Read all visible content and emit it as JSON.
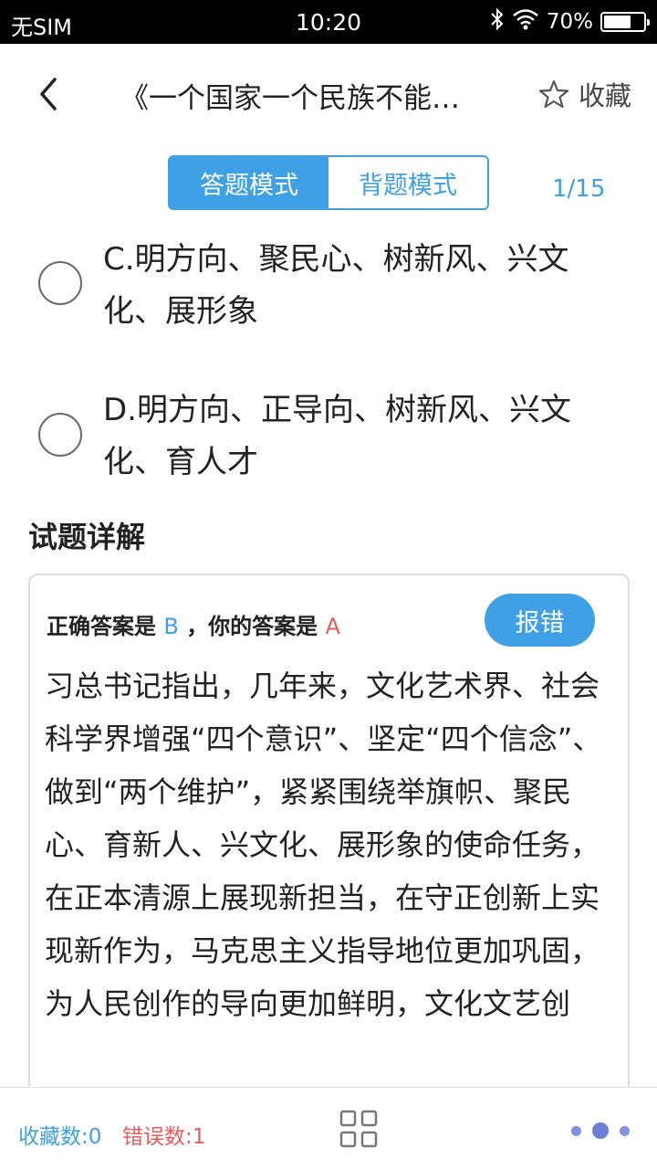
{
  "status_bar": {
    "carrier": "无SIM",
    "time": "10:20",
    "battery_percent": "70%",
    "battery_level": 0.7,
    "icons": [
      "bluetooth-icon",
      "wifi-icon",
      "battery-icon"
    ]
  },
  "header": {
    "title": "《一个国家一个民族不能…",
    "favorite_label": "收藏",
    "icons": [
      "back-arrow-icon",
      "star-outline-icon"
    ]
  },
  "mode_toggle": {
    "answer_mode": "答题模式",
    "review_mode": "背题模式",
    "active": "answer_mode"
  },
  "progress": "1/15",
  "options": [
    {
      "text": "C.明方向、聚民心、树新风、兴文化、展形象",
      "selected": false
    },
    {
      "text": "D.明方向、正导向、树新风、兴文化、育人才",
      "selected": false
    }
  ],
  "detail": {
    "heading": "试题详解",
    "correct_prefix": "正确答案是",
    "correct_answer": "B",
    "your_prefix": "，你的答案是",
    "your_answer": "A",
    "report_label": "报错",
    "explanation": "习总书记指出，几年来，文化艺术界、社会科学界增强“四个意识”、坚定“四个信念”、做到“两个维护”，紧紧围绕举旗帜、聚民心、育新人、兴文化、展形象的使命任务，在正本清源上展现新担当，在守正创新上实现新作为，马克思主义指导地位更加巩固，为人民创作的导向更加鲜明，文化文艺创"
  },
  "bottom_bar": {
    "favorite_count": "收藏数:0",
    "error_count": "错误数:1",
    "icons": [
      "grid-icon",
      "more-dots-icon"
    ]
  },
  "colors": {
    "accent": "#3fa0e5",
    "error": "#e95b5b",
    "dots": "#6c7fd8"
  }
}
